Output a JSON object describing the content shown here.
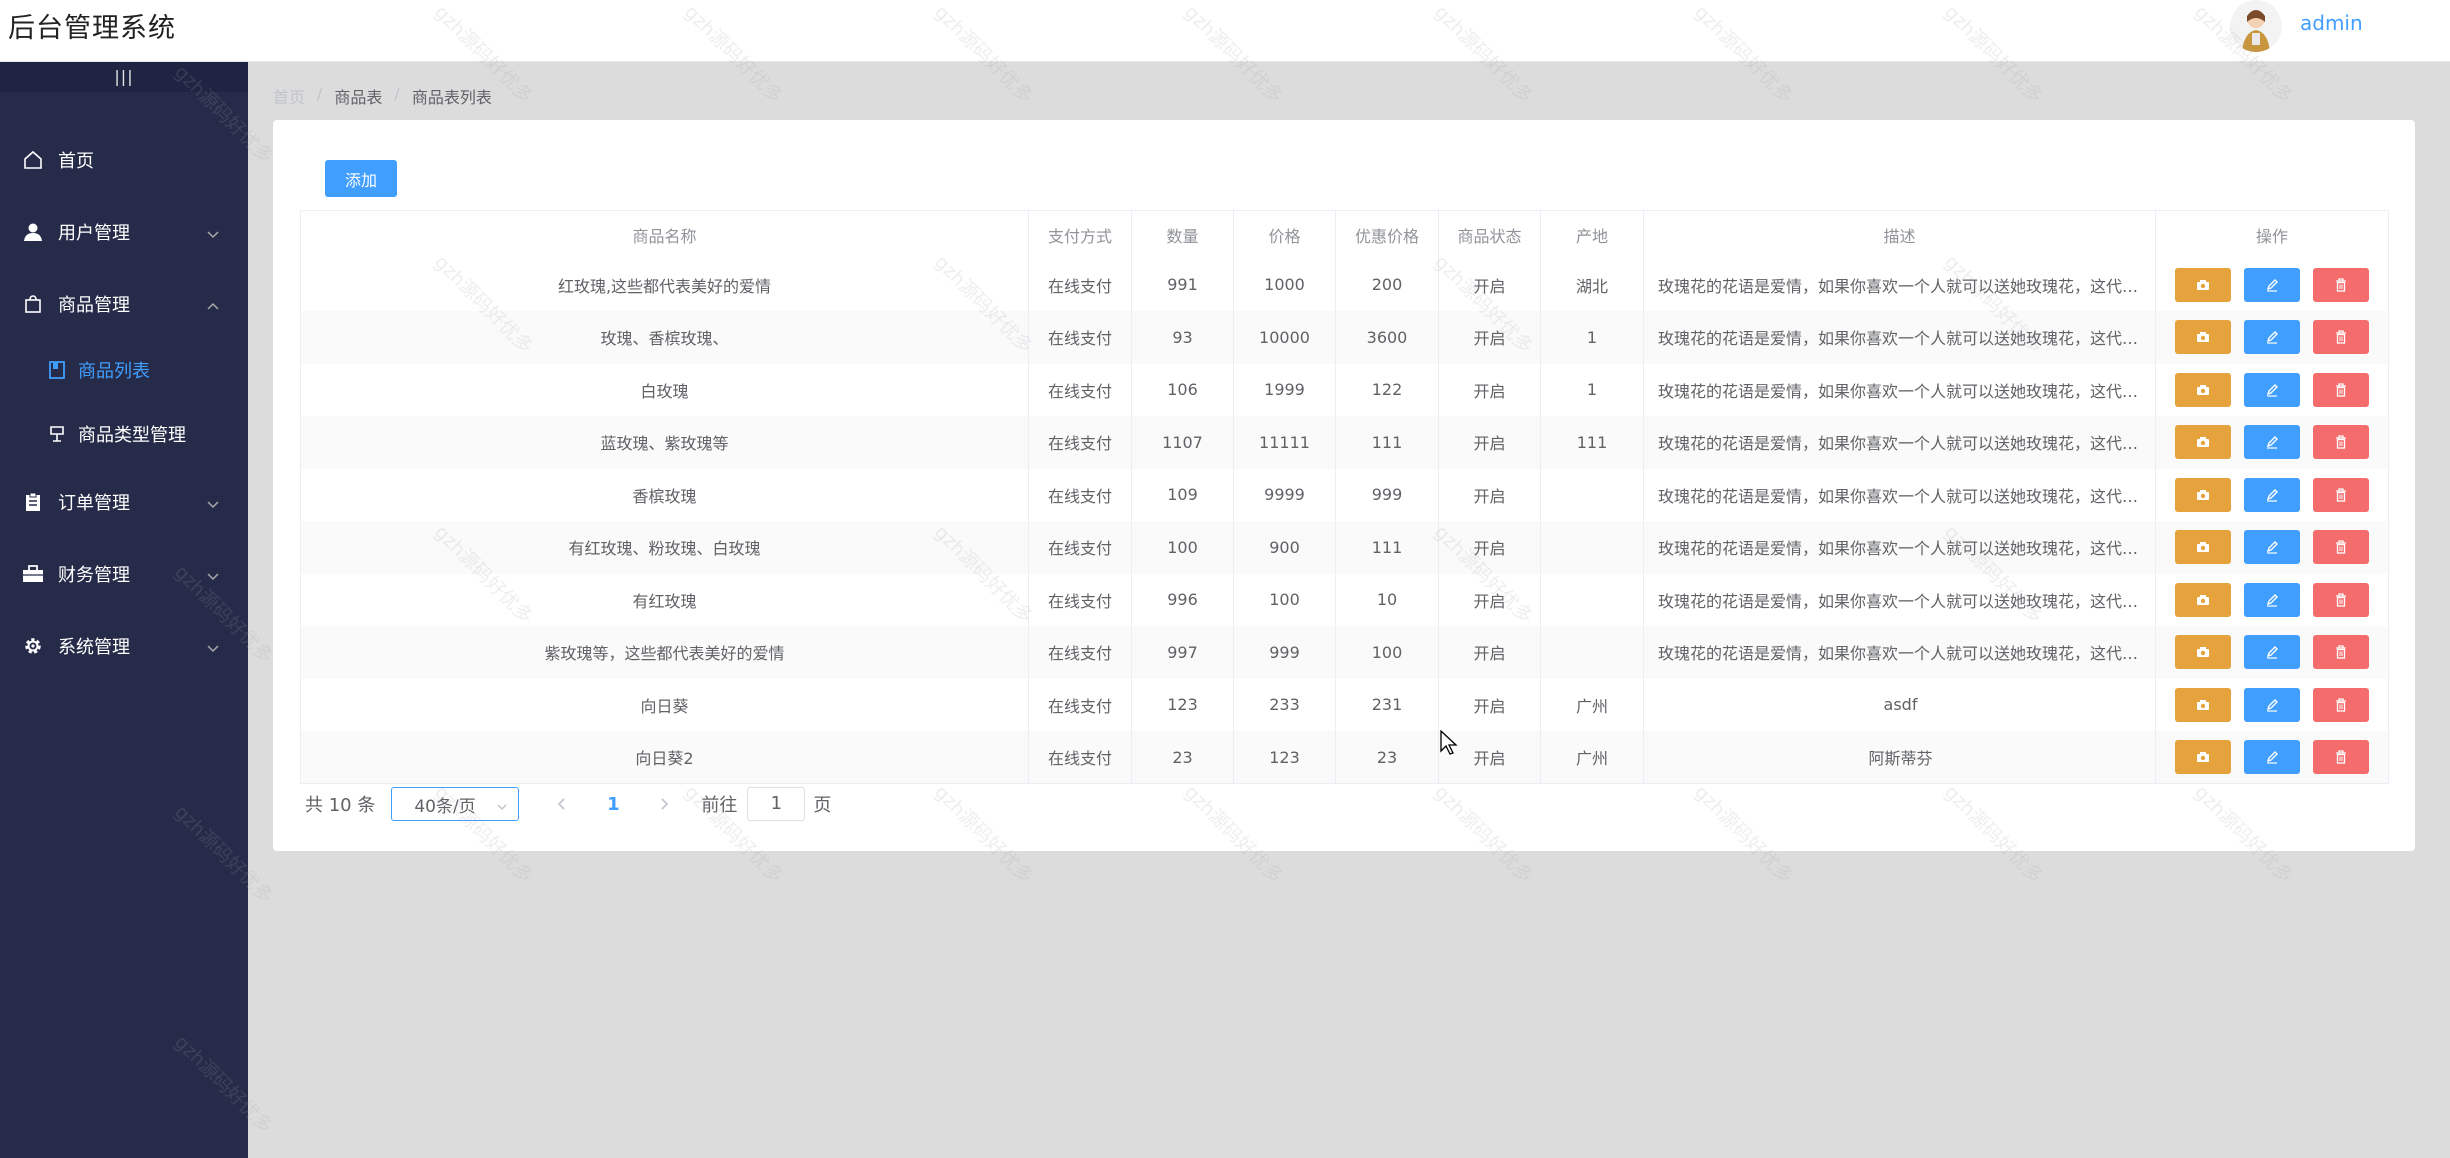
{
  "header": {
    "title": "后台管理系统",
    "user": "admin"
  },
  "sidebar": {
    "collapse_glyph": "|||",
    "items": [
      {
        "label": "首页",
        "icon": "home-icon",
        "expandable": false
      },
      {
        "label": "用户管理",
        "icon": "user-icon",
        "expandable": true,
        "expanded": false
      },
      {
        "label": "商品管理",
        "icon": "bag-icon",
        "expandable": true,
        "expanded": true
      },
      {
        "label": "商品列表",
        "icon": "book-icon",
        "sub": true,
        "active": true
      },
      {
        "label": "商品类型管理",
        "icon": "lamp-icon",
        "sub": true
      },
      {
        "label": "订单管理",
        "icon": "clipboard-icon",
        "expandable": true,
        "expanded": false
      },
      {
        "label": "财务管理",
        "icon": "briefcase-icon",
        "expandable": true,
        "expanded": false
      },
      {
        "label": "系统管理",
        "icon": "gear-icon",
        "expandable": true,
        "expanded": false
      }
    ]
  },
  "breadcrumb": [
    "首页",
    "商品表",
    "商品表列表"
  ],
  "toolbar": {
    "add_label": "添加"
  },
  "table": {
    "columns": [
      "商品名称",
      "支付方式",
      "数量",
      "价格",
      "优惠价格",
      "商品状态",
      "产地",
      "描述",
      "操作"
    ],
    "rows": [
      [
        "红玫瑰,这些都代表美好的爱情",
        "在线支付",
        "991",
        "1000",
        "200",
        "开启",
        "湖北",
        "玫瑰花的花语是爱情，如果你喜欢一个人就可以送她玫瑰花，这代表..."
      ],
      [
        "玫瑰、香槟玫瑰、",
        "在线支付",
        "93",
        "10000",
        "3600",
        "开启",
        "1",
        "玫瑰花的花语是爱情，如果你喜欢一个人就可以送她玫瑰花，这代表..."
      ],
      [
        "白玫瑰",
        "在线支付",
        "106",
        "1999",
        "122",
        "开启",
        "1",
        "玫瑰花的花语是爱情，如果你喜欢一个人就可以送她玫瑰花，这代表..."
      ],
      [
        "蓝玫瑰、紫玫瑰等",
        "在线支付",
        "1107",
        "11111",
        "111",
        "开启",
        "111",
        "玫瑰花的花语是爱情，如果你喜欢一个人就可以送她玫瑰花，这代表..."
      ],
      [
        "香槟玫瑰",
        "在线支付",
        "109",
        "9999",
        "999",
        "开启",
        "",
        "玫瑰花的花语是爱情，如果你喜欢一个人就可以送她玫瑰花，这代表..."
      ],
      [
        "有红玫瑰、粉玫瑰、白玫瑰",
        "在线支付",
        "100",
        "900",
        "111",
        "开启",
        "",
        "玫瑰花的花语是爱情，如果你喜欢一个人就可以送她玫瑰花，这代表..."
      ],
      [
        "有红玫瑰",
        "在线支付",
        "996",
        "100",
        "10",
        "开启",
        "",
        "玫瑰花的花语是爱情，如果你喜欢一个人就可以送她玫瑰花，这代表..."
      ],
      [
        "紫玫瑰等，这些都代表美好的爱情",
        "在线支付",
        "997",
        "999",
        "100",
        "开启",
        "",
        "玫瑰花的花语是爱情，如果你喜欢一个人就可以送她玫瑰花，这代表..."
      ],
      [
        "向日葵",
        "在线支付",
        "123",
        "233",
        "231",
        "开启",
        "广州",
        "asdf"
      ],
      [
        "向日葵2",
        "在线支付",
        "23",
        "123",
        "23",
        "开启",
        "广州",
        "阿斯蒂芬"
      ]
    ]
  },
  "pagination": {
    "total_label": "共 10 条",
    "page_size": "40条/页",
    "current_page": "1",
    "goto_prefix": "前往",
    "goto_value": "1",
    "goto_suffix": "页"
  },
  "watermark": "gzh源码好优多",
  "colors": {
    "primary": "#409eff",
    "warning": "#e6a23c",
    "danger": "#f56c6c",
    "sidebar_bg": "#262b49"
  }
}
